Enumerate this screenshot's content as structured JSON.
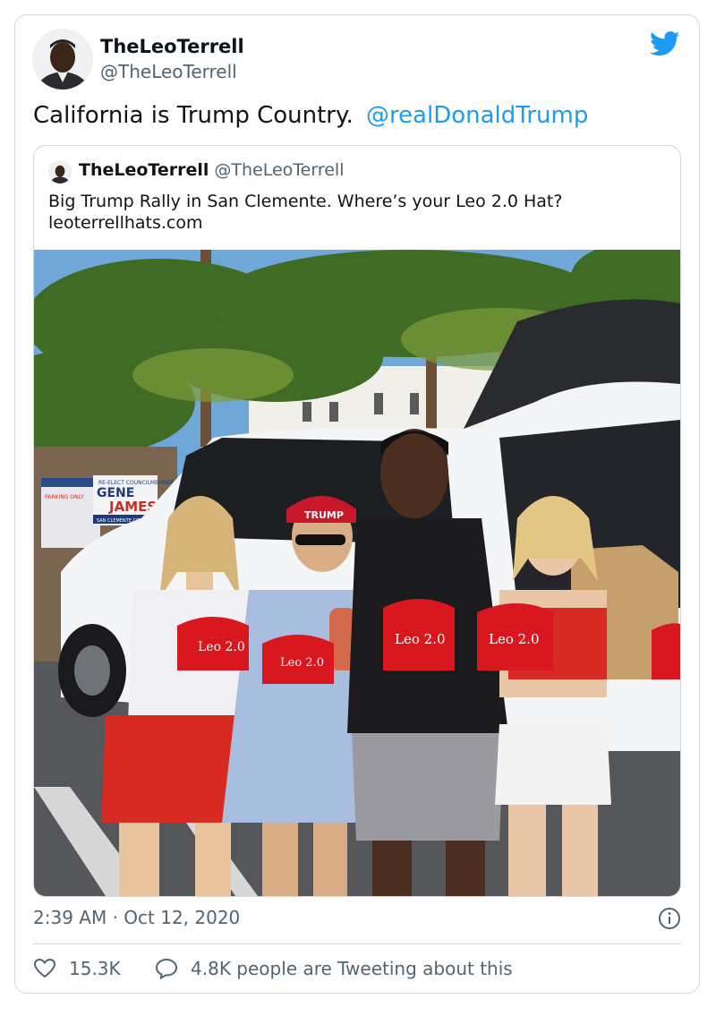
{
  "author": {
    "name": "TheLeoTerrell",
    "handle": "@TheLeoTerrell"
  },
  "tweet": {
    "text": "California is Trump Country.",
    "mention": "@realDonaldTrump"
  },
  "quoted_tweet": {
    "name": "TheLeoTerrell",
    "handle": "@TheLeoTerrell",
    "text_line1": "Big Trump Rally in San Clemente. Where’s your Leo 2.0 Hat?",
    "text_line2": "leoterrellhats.com"
  },
  "photo": {
    "sign_lines": [
      "RE-ELECT COUNCILMEMBER",
      "GENE",
      "JAMES",
      "SAN CLEMENTE CITY COUNCIL"
    ],
    "parking_sign": "PARKING ONLY",
    "visor_text": "TRUMP",
    "hat_label": "Leo 2.0"
  },
  "footer": {
    "timestamp": "2:39 AM · Oct 12, 2020",
    "likes": "15.3K",
    "tweeting": "4.8K people are Tweeting about this"
  },
  "colors": {
    "twitter_blue": "#1d9bf0",
    "text_secondary": "#536471",
    "border": "#cfd9de",
    "hat_red": "#d8171e"
  }
}
